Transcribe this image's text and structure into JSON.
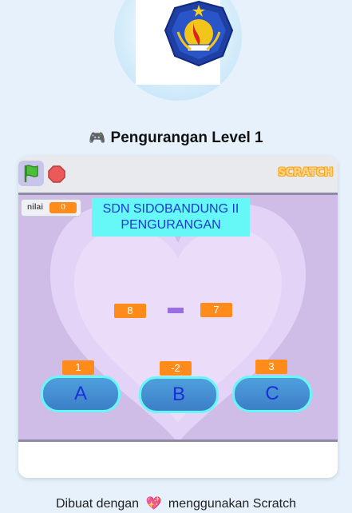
{
  "header": {
    "logo_name": "school-emblem",
    "title_icon": "🎮",
    "title": "Pengurangan Level 1"
  },
  "player": {
    "controls": {
      "flag_icon": "green-flag-icon",
      "stop_icon": "stop-icon"
    },
    "brand": "SCRATCH"
  },
  "stage": {
    "score": {
      "label": "nilai",
      "value": "0"
    },
    "banner": {
      "line1": "SDN SIDOBANDUNG II",
      "line2": "PENGURANGAN"
    },
    "problem": {
      "left": "8",
      "operator": "-",
      "right": "7"
    },
    "answers": [
      {
        "letter": "A",
        "value": "1"
      },
      {
        "letter": "B",
        "value": "-2"
      },
      {
        "letter": "C",
        "value": "3"
      }
    ]
  },
  "footer": {
    "prefix": "Dibuat dengan",
    "heart": "💖",
    "suffix": "menggunakan Scratch"
  },
  "colors": {
    "page_bg": "#e6f1fb",
    "stage_bg": "#cfbde8",
    "banner_bg": "#66f7f7",
    "banner_text": "#1a3ccc",
    "number_box": "#ff8c1a",
    "answer_button": "#3c7fc8"
  }
}
